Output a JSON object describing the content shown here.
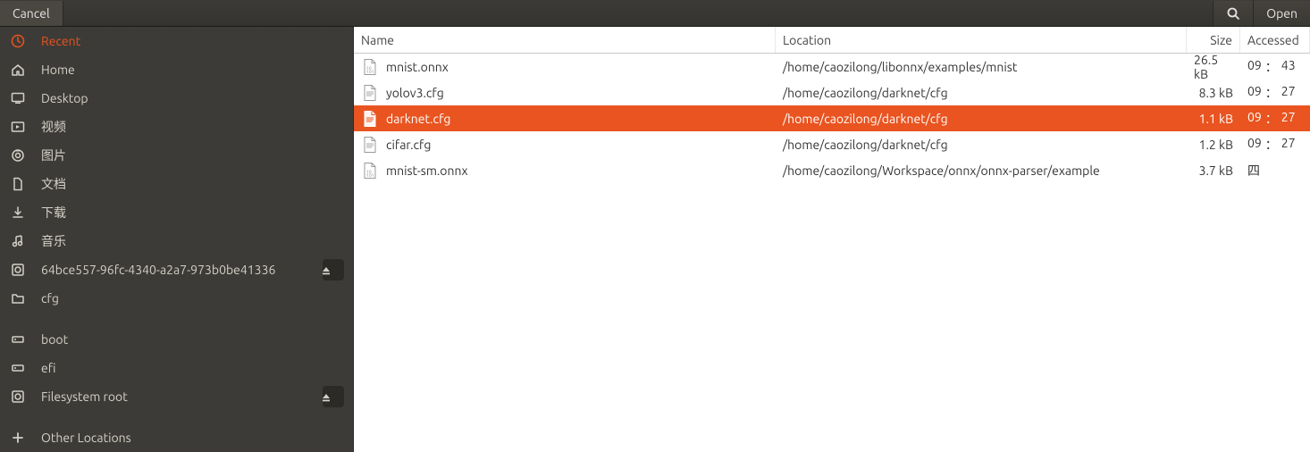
{
  "titlebar": {
    "cancel": "Cancel",
    "open": "Open"
  },
  "sidebar": {
    "items": [
      {
        "icon": "clock-icon",
        "label": "Recent",
        "active": true
      },
      {
        "icon": "home-icon",
        "label": "Home"
      },
      {
        "icon": "desktop-icon",
        "label": "Desktop"
      },
      {
        "icon": "videos-icon",
        "label": "视频"
      },
      {
        "icon": "pictures-icon",
        "label": "图片"
      },
      {
        "icon": "documents-icon",
        "label": "文档"
      },
      {
        "icon": "downloads-icon",
        "label": "下载"
      },
      {
        "icon": "music-icon",
        "label": "音乐"
      },
      {
        "icon": "disk-icon",
        "label": "64bce557-96fc-4340-a2a7-973b0be41336",
        "eject": true
      },
      {
        "icon": "folder-icon",
        "label": "cfg"
      }
    ],
    "items2": [
      {
        "icon": "drive-icon",
        "label": "boot"
      },
      {
        "icon": "drive-icon",
        "label": "efi"
      },
      {
        "icon": "disk-icon",
        "label": "Filesystem root",
        "eject": true
      }
    ],
    "items3": [
      {
        "icon": "plus-icon",
        "label": "Other Locations"
      }
    ]
  },
  "columns": {
    "name": "Name",
    "location": "Location",
    "size": "Size",
    "accessed": "Accessed"
  },
  "files": [
    {
      "name": "mnist.onnx",
      "location": "/home/caozilong/libonnx/examples/mnist",
      "size": "26.5 kB",
      "accessed_h": "09",
      "accessed_m": "43",
      "icon": "binfile"
    },
    {
      "name": "yolov3.cfg",
      "location": "/home/caozilong/darknet/cfg",
      "size": "8.3 kB",
      "accessed_h": "09",
      "accessed_m": "27",
      "icon": "txtfile"
    },
    {
      "name": "darknet.cfg",
      "location": "/home/caozilong/darknet/cfg",
      "size": "1.1 kB",
      "accessed_h": "09",
      "accessed_m": "27",
      "icon": "txtfile",
      "selected": true
    },
    {
      "name": "cifar.cfg",
      "location": "/home/caozilong/darknet/cfg",
      "size": "1.2 kB",
      "accessed_h": "09",
      "accessed_m": "27",
      "icon": "txtfile"
    },
    {
      "name": "mnist-sm.onnx",
      "location": "/home/caozilong/Workspace/onnx/onnx-parser/example",
      "size": "3.7 kB",
      "accessed_text": "四",
      "icon": "binfile"
    }
  ]
}
